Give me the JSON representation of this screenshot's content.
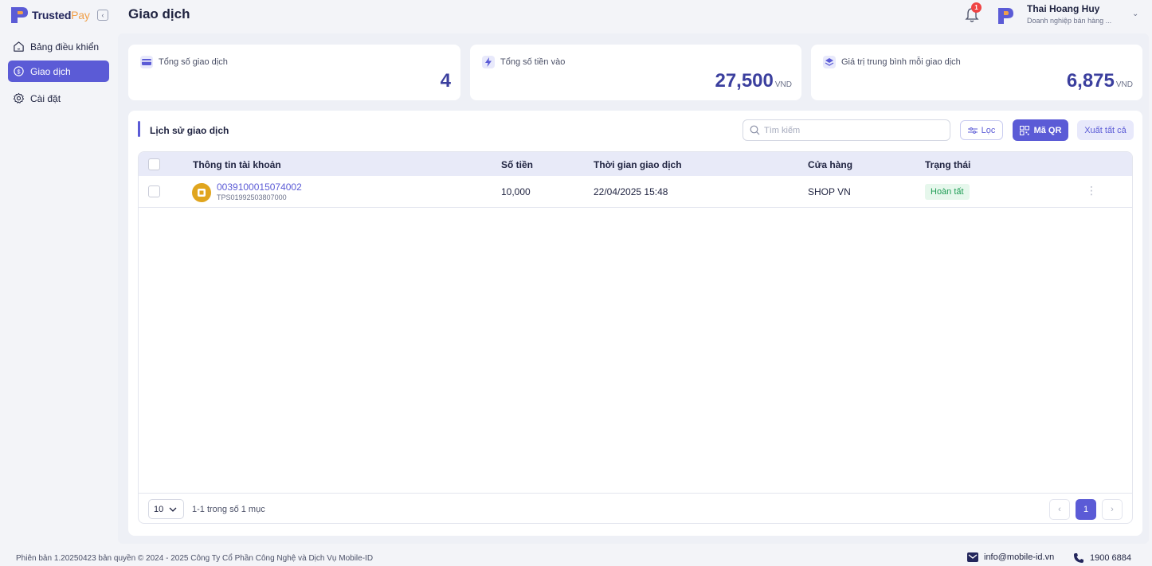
{
  "brand": {
    "name_part1": "Trusted",
    "name_part2": "Pay"
  },
  "header": {
    "title": "Giao dịch",
    "notification_count": "1",
    "user_name": "Thai Hoang Huy",
    "user_role": "Doanh nghiệp bán hàng ..."
  },
  "sidebar": {
    "items": [
      {
        "label": "Bảng điều khiển",
        "icon": "home-icon",
        "active": false
      },
      {
        "label": "Giao dịch",
        "icon": "money-icon",
        "active": true
      },
      {
        "label": "Cài đặt",
        "icon": "gear-icon",
        "active": false
      }
    ]
  },
  "stats": [
    {
      "label": "Tổng số giao dịch",
      "value": "4",
      "unit": "",
      "icon": "card-icon",
      "color": "#5b5bd6"
    },
    {
      "label": "Tổng số tiền vào",
      "value": "27,500",
      "unit": "VND",
      "icon": "lightning-icon",
      "color": "#5b5bd6"
    },
    {
      "label": "Giá trị trung bình mỗi giao dịch",
      "value": "6,875",
      "unit": "VND",
      "icon": "layers-icon",
      "color": "#5b5bd6"
    }
  ],
  "history": {
    "title": "Lịch sử giao dịch",
    "search_placeholder": "Tìm kiếm",
    "filter_label": "Lọc",
    "qr_label": "Mã QR",
    "export_label": "Xuất tất cả",
    "columns": [
      "Thông tin tài khoản",
      "Số tiền",
      "Thời gian giao dịch",
      "Cửa hàng",
      "Trạng thái"
    ],
    "rows": [
      {
        "account_no": "0039100015074002",
        "ref": "TPS01992503807000",
        "amount": "10,000",
        "time": "22/04/2025 15:48",
        "store": "SHOP VN",
        "status": "Hoàn tất"
      }
    ],
    "page_size": "10",
    "range_text": "1-1 trong số 1 mục",
    "current_page": "1"
  },
  "footer": {
    "copyright": "Phiên bản 1.20250423 bản quyền © 2024 - 2025 Công Ty Cổ Phần Công Nghệ và Dịch Vụ Mobile-ID",
    "email": "info@mobile-id.vn",
    "phone": "1900 6884"
  },
  "colors": {
    "accent": "#5b5bd6",
    "brand_orange": "#f0a04a",
    "success": "#1f9d55"
  }
}
